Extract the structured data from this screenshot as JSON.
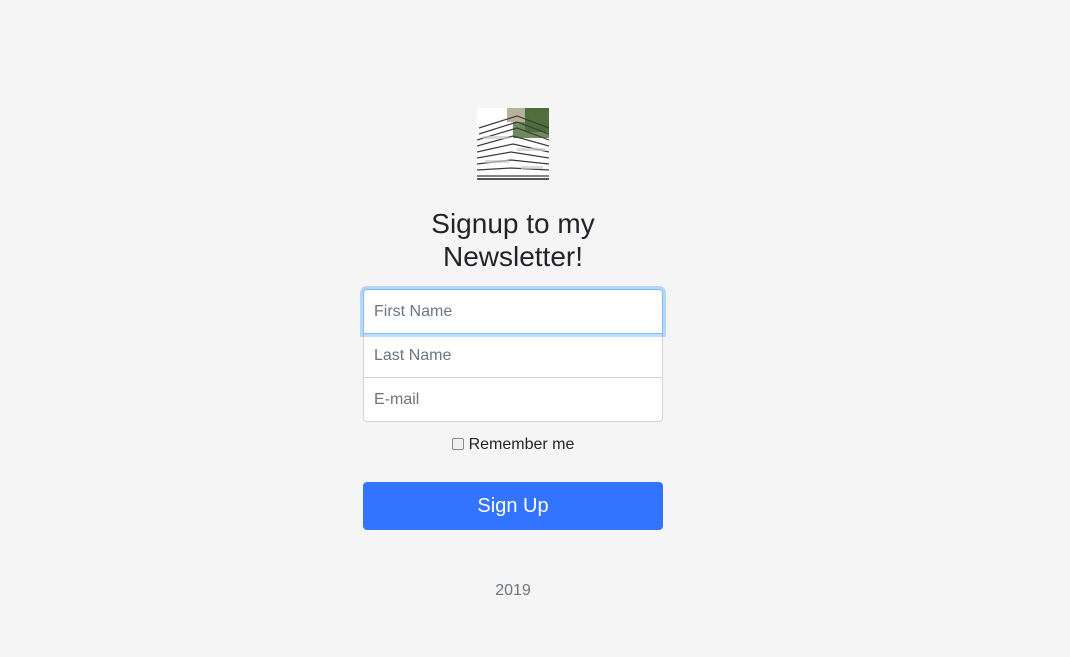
{
  "logo": {
    "icon": "newspaper-stack-icon"
  },
  "heading": {
    "line1": "Signup to my",
    "line2": "Newsletter!"
  },
  "form": {
    "first_name_placeholder": "First Name",
    "last_name_placeholder": "Last Name",
    "email_placeholder": "E-mail",
    "remember_label": "Remember me",
    "submit_label": "Sign Up"
  },
  "footer": {
    "text": "2019"
  },
  "colors": {
    "accent": "#3273ff",
    "background": "#f5f5f5"
  }
}
